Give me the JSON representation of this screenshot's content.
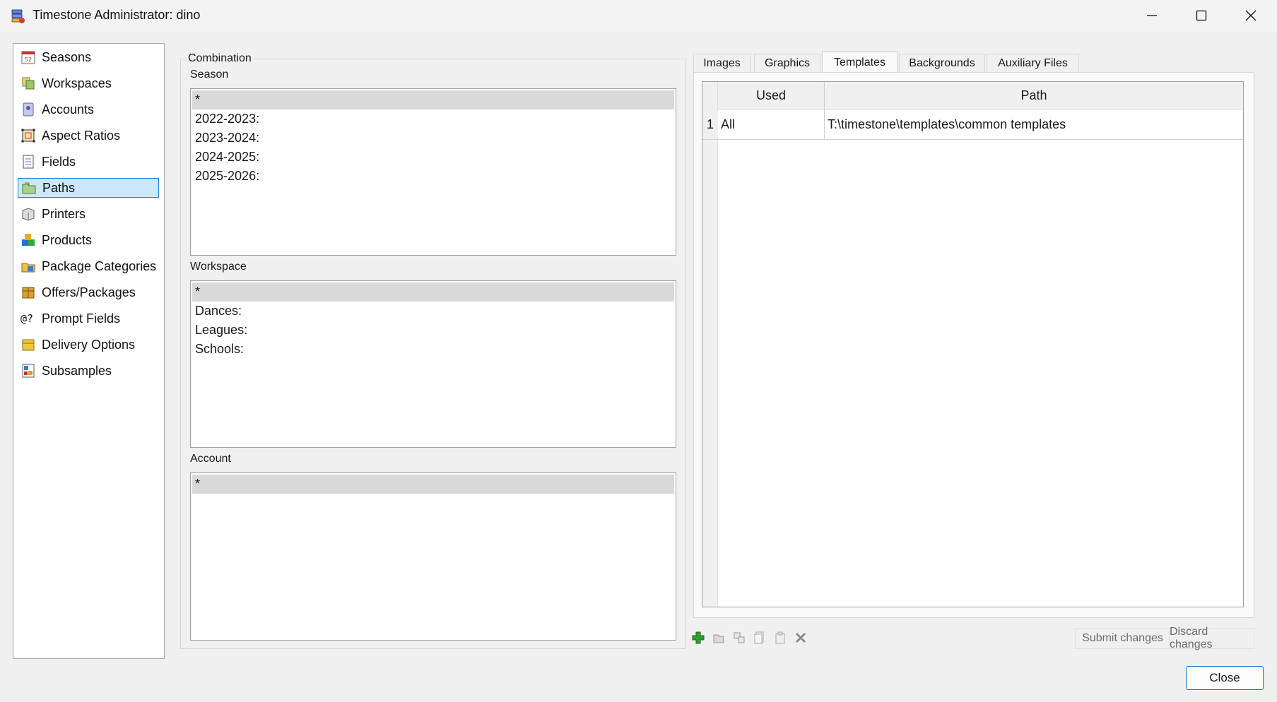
{
  "window": {
    "title": "Timestone Administrator: dino",
    "app_icon": "database-stack-icon",
    "controls": [
      "minimize-icon",
      "maximize-icon",
      "close-icon"
    ]
  },
  "nav": {
    "items": [
      {
        "label": "Seasons",
        "icon": "calendar-icon"
      },
      {
        "label": "Workspaces",
        "icon": "workspaces-icon"
      },
      {
        "label": "Accounts",
        "icon": "accounts-icon"
      },
      {
        "label": "Aspect Ratios",
        "icon": "aspect-ratio-icon"
      },
      {
        "label": "Fields",
        "icon": "fields-icon"
      },
      {
        "label": "Paths",
        "icon": "paths-icon",
        "selected": true
      },
      {
        "label": "Printers",
        "icon": "printer-icon"
      },
      {
        "label": "Products",
        "icon": "products-icon"
      },
      {
        "label": "Package Categories",
        "icon": "package-categories-icon"
      },
      {
        "label": "Offers/Packages",
        "icon": "offers-packages-icon"
      },
      {
        "label": "Prompt Fields",
        "icon": "prompt-fields-icon"
      },
      {
        "label": "Delivery Options",
        "icon": "delivery-options-icon"
      },
      {
        "label": "Subsamples",
        "icon": "subsamples-icon"
      }
    ],
    "prompt_fields_glyph": "@?"
  },
  "combination": {
    "caption": "Combination",
    "season": {
      "label": "Season",
      "items": [
        "*",
        "2022-2023:",
        "2023-2024:",
        "2024-2025:",
        "2025-2026:"
      ]
    },
    "workspace": {
      "label": "Workspace",
      "items": [
        "*",
        "Dances:",
        "Leagues:",
        "Schools:"
      ]
    },
    "account": {
      "label": "Account",
      "items": [
        "*"
      ]
    }
  },
  "tabs": {
    "items": [
      "Images",
      "Graphics",
      "Templates",
      "Backgrounds",
      "Auxiliary Files"
    ],
    "active": "Templates"
  },
  "grid": {
    "columns": [
      "Used",
      "Path"
    ],
    "rows": [
      {
        "num": "1",
        "used": "All",
        "path": "T:\\timestone\\templates\\common templates"
      }
    ]
  },
  "toolbar": {
    "icons": [
      "add-icon",
      "edit-icon",
      "duplicate-icon",
      "copy-icon",
      "paste-icon",
      "delete-icon"
    ],
    "submit_label": "Submit changes",
    "discard_label": "Discard changes"
  },
  "footer": {
    "close_label": "Close"
  },
  "colors": {
    "selection_bg": "#cce8ff",
    "selection_border": "#1e7fd1",
    "list_selected_row": "#d9d9d9",
    "add_green": "#2e9e2e"
  }
}
